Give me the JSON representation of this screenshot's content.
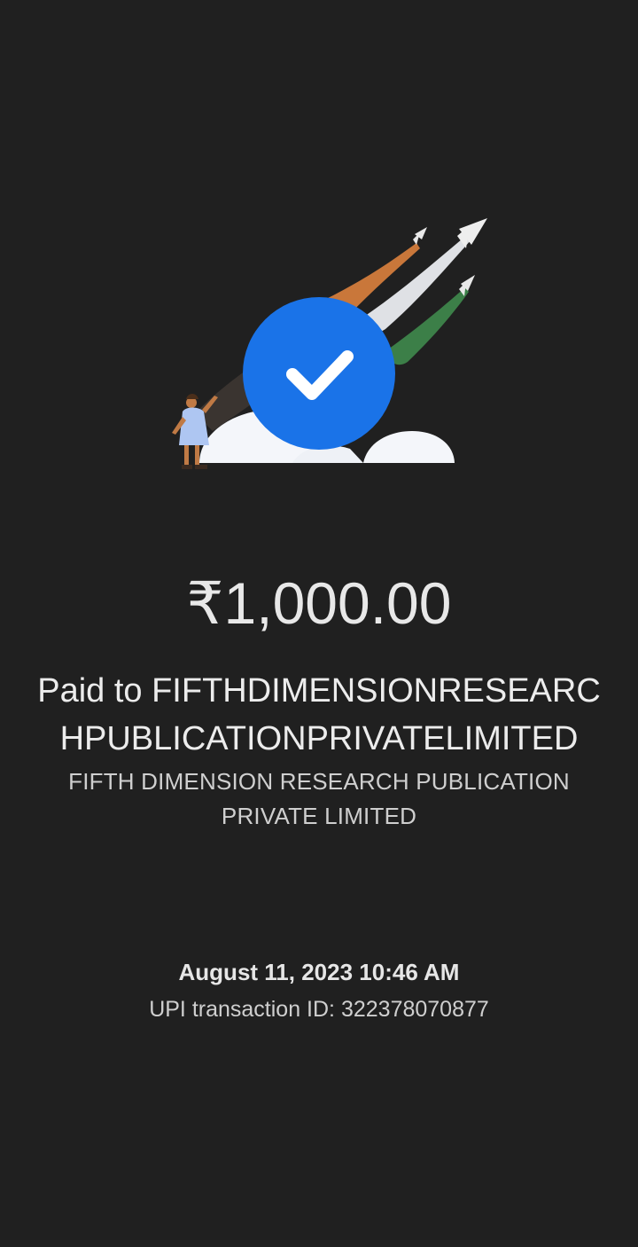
{
  "payment": {
    "amount": "₹1,000.00",
    "paid_to": "Paid to FIFTHDIMENSIONRESEARCHPUBLICATIONPRIVATELIMITED",
    "merchant_name": "FIFTH DIMENSION RESEARCH PUBLICATION PRIVATE LIMITED",
    "datetime": "August 11, 2023 10:46 AM",
    "transaction_id": "UPI transaction ID: 322378070877"
  },
  "illustration": {
    "icon": "check-icon",
    "colors": {
      "badge": "#1a73e8",
      "trail_saffron": "#c9773a",
      "trail_white": "#dfe1e5",
      "trail_green": "#3c7f48",
      "cloud": "#f4f6fa"
    }
  },
  "theme": {
    "background": "#202020",
    "text_primary": "#e6e6e6",
    "text_secondary": "#cfcfcf"
  }
}
